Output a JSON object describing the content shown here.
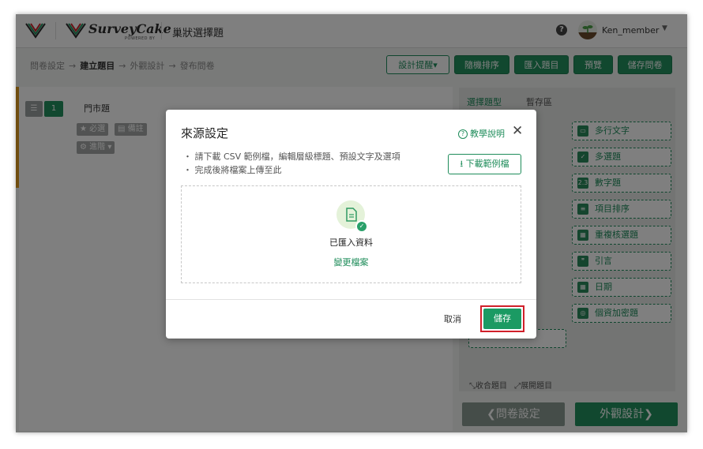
{
  "app": {
    "brand": "SurveyCake",
    "brand_sub": "POWERED BY",
    "page_name": "巢狀選擇題",
    "username": "Ken_member"
  },
  "breadcrumb": {
    "steps": [
      "問卷設定",
      "建立題目",
      "外觀設計",
      "發布問卷"
    ],
    "current": 1
  },
  "toolbar": {
    "design_hint": "設計提醒",
    "random_sort": "隨機排序",
    "import": "匯入題目",
    "preview": "預覽",
    "save_survey": "儲存問卷"
  },
  "question": {
    "number": "1",
    "title": "門市題",
    "tags": [
      "必選",
      "備註",
      "進階"
    ]
  },
  "right_panel": {
    "tabs": [
      "選擇題型",
      "暫存區"
    ],
    "types": [
      "多行文字",
      "多選題",
      "數字題",
      "項目排序",
      "重複核選題",
      "引言",
      "日期",
      "個資加密題"
    ],
    "type_icons": [
      "textarea-icon",
      "checkbox-icon",
      "number-icon",
      "sort-icon",
      "grid-icon",
      "quote-icon",
      "calendar-icon",
      "lock-icon"
    ],
    "collapse": "收合題目",
    "expand": "展開題目",
    "prev": "問卷設定",
    "next": "外觀設計"
  },
  "modal": {
    "title": "來源設定",
    "help": "教學說明",
    "info": [
      "請下載 CSV 範例檔，編輯層級標題、預設文字及選項",
      "完成後將檔案上傳至此"
    ],
    "download": "下載範例檔",
    "status": "已匯入資料",
    "change": "變更檔案",
    "cancel": "取消",
    "save": "儲存"
  },
  "colors": {
    "brand_green": "#23915f",
    "accent_orange": "#e09a1d",
    "highlight_red": "#d0202a"
  }
}
